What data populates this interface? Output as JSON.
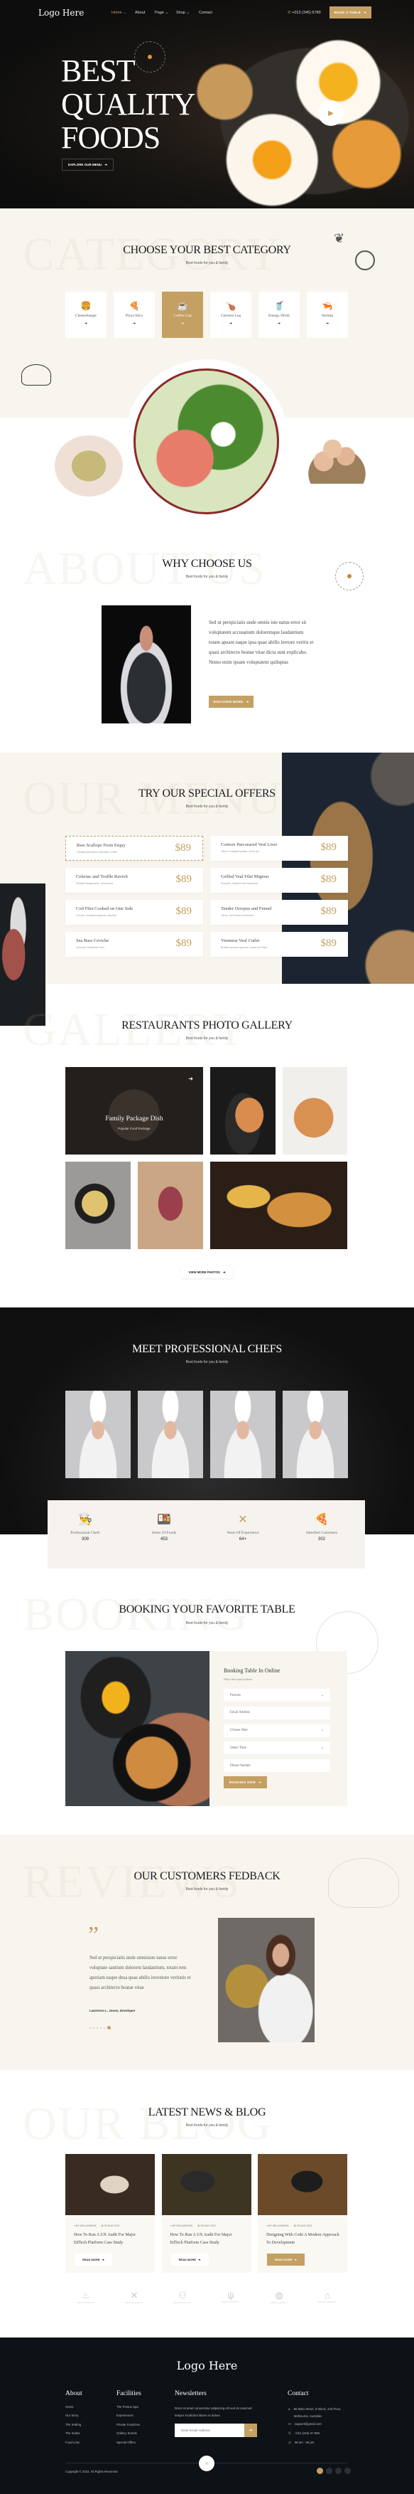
{
  "colors": {
    "accent": "#c4a063",
    "dark": "#0d1114",
    "cream": "#f8f5ef"
  },
  "header": {
    "logo": "Logo Here",
    "nav": [
      {
        "label": "Home",
        "dropdown": true,
        "active": true
      },
      {
        "label": "About",
        "dropdown": false
      },
      {
        "label": "Page",
        "dropdown": true
      },
      {
        "label": "Shop",
        "dropdown": true
      },
      {
        "label": "Contact",
        "dropdown": false
      }
    ],
    "phone": "+012 (345) 6789",
    "book_button": "BOOK A TABLE"
  },
  "hero": {
    "title_lines": [
      "BEST",
      "QUALITY",
      "FOODS"
    ],
    "badge_text": "BEST QUALITY FOODS",
    "explore_button": "EXPLORE OUR MENU",
    "play_icon": "play-icon"
  },
  "category": {
    "watermark": "CATEGORY",
    "title": "CHOOSE YOUR BEST CATEGORY",
    "subtitle": "Best foods for you & family",
    "items": [
      {
        "label": "Cheeseburger",
        "icon": "burger-icon",
        "glyph": "🍔",
        "active": false
      },
      {
        "label": "Pizza Slice",
        "icon": "pizza-icon",
        "glyph": "🍕",
        "active": false
      },
      {
        "label": "Coffee Cup",
        "icon": "coffee-icon",
        "glyph": "☕",
        "active": true
      },
      {
        "label": "Chicken Leg",
        "icon": "chicken-leg-icon",
        "glyph": "🍗",
        "active": false
      },
      {
        "label": "Energy Drink",
        "icon": "drink-icon",
        "glyph": "🥤",
        "active": false
      },
      {
        "label": "Shrimp",
        "icon": "shrimp-icon",
        "glyph": "🦐",
        "active": false
      }
    ]
  },
  "about": {
    "watermark": "ABOUT US",
    "title": "WHY CHOOSE US",
    "subtitle": "Best foods for you & family",
    "text": "Sed ut perspiciatis unde omnis iste natus error sit voluptatem accusatium doloremque laudantium totam apeam eaque ipsa quae abillo invtore veritis et quasi architecto beatae vitae dicta sunt explicabo. Nemo enim ipsam voluptatem quiluptas",
    "button": "DISCOVER MORE"
  },
  "menu": {
    "watermark": "OUR MENU",
    "title": "TRY OUR SPECIAL OFFERS",
    "subtitle": "Best foods for you & family",
    "items": [
      {
        "name": "Raw Scallops From Erquy",
        "desc": "Candied jerusalem artichoke, truffle",
        "price": "$89"
      },
      {
        "name": "Correze Pan-seared Veal Liver",
        "desc": "Olive or mashed potato, onion jus",
        "price": "$89"
      },
      {
        "name": "Celeriac and Truffle Ravioli",
        "desc": "Roasted langoustine, consomme",
        "price": "$89"
      },
      {
        "name": "Grilled Veal Filet Mignon",
        "desc": "Pumpkin, endives with hazelnuts",
        "price": "$89"
      },
      {
        "name": "Cod Filet Cooked on One Side",
        "desc": "Chorizo, chickpea espuma, piquillos",
        "price": "$89"
      },
      {
        "name": "Tender Octopus and Fennel",
        "desc": "Citrus, wild fennel condiment",
        "price": "$89"
      },
      {
        "name": "Sea Bass Ceviche",
        "desc": "Avocado, buttermilk, lime",
        "price": "$89"
      },
      {
        "name": "Viennese Veal Cutlet",
        "desc": "Braised spinach gnocchi, sauce de Pepe",
        "price": "$89"
      }
    ]
  },
  "gallery": {
    "watermark": "GALLERY",
    "title": "RESTAURANTS PHOTO GALLERY",
    "subtitle": "Best foods for you & family",
    "featured_title": "Family Package Dish",
    "featured_sub": "Popular Food Package",
    "button": "VIEW MORE PHOTOS"
  },
  "chefs": {
    "title": "MEET PROFESSIONAL CHEFS",
    "subtitle": "Best foods for you & family",
    "stats": [
      {
        "label": "Professional Chefs",
        "value": "309",
        "icon": "chef-hat-icon",
        "glyph": "👨‍🍳"
      },
      {
        "label": "Items Of Foods",
        "value": "453",
        "icon": "food-items-icon",
        "glyph": "🍱"
      },
      {
        "label": "Years Of Experience",
        "value": "64+",
        "icon": "utensils-icon",
        "glyph": "✕"
      },
      {
        "label": "Satisfied Customers",
        "value": "302",
        "icon": "pizza-slice-icon",
        "glyph": "🍕"
      }
    ]
  },
  "booking": {
    "watermark": "BOOKING",
    "title": "BOOKING YOUR FAVORITE TABLE",
    "subtitle": "Best foods for you & family",
    "form_title": "Booking Table In Online",
    "form_sub": "Fillup the input options",
    "fields": [
      {
        "placeholder": "Persons",
        "select": true
      },
      {
        "placeholder": "Email Address",
        "select": false
      },
      {
        "placeholder": "Choose Date",
        "select": true
      },
      {
        "placeholder": "Select Time",
        "select": true
      },
      {
        "placeholder": "Phone Number",
        "select": false
      }
    ],
    "button": "BOOKING NOW"
  },
  "reviews": {
    "watermark": "REVIEWS",
    "title": "OUR CUSTOMERS FEDBACK",
    "subtitle": "Best foods for you & family",
    "text": "Sed ut perspiciatis unde omnisiste natus error voluptate santium dolorem laudantium, totam rem aperiam eaque desa quae abillo inventore veritatis et quasi architecto beatae vitae",
    "author": "Lawrence L. Jones, Developer",
    "slides": 6,
    "active_slide": 6
  },
  "blog": {
    "watermark": "OUR BLOG",
    "title": "LATEST NEWS & BLOG",
    "subtitle": "Best foods for you & family",
    "posts": [
      {
        "author": "BY WILLIAMSON",
        "date": "25 AUG 2021",
        "title": "How To Run A UX Audit For Major EdTech Platform Case Study",
        "button": "READ MORE",
        "highlight": false
      },
      {
        "author": "BY WILLIAMSON",
        "date": "25 AUG 2021",
        "title": "How To Run A UX Audit For Major EdTech Platform Case Study",
        "button": "READ MORE",
        "highlight": false
      },
      {
        "author": "BY WILLIAMSON",
        "date": "25 AUG 2021",
        "title": "Designing With Code A Modern Approach To Development",
        "button": "READ MORE",
        "highlight": true
      }
    ]
  },
  "partners": [
    "RESTAURANT",
    "RESTAURANT",
    "RESTAURANT",
    "RESTAURANT",
    "RESTAURANT",
    "RESTAURANT"
  ],
  "footer": {
    "logo": "Logo Here",
    "about": {
      "title": "About",
      "links": [
        "Home",
        "Our Story",
        "The Setting",
        "The Suites",
        "Food Lists"
      ]
    },
    "facilities": {
      "title": "Facilities",
      "links": [
        "The Pontus Spa",
        "Experiences",
        "Private Functions",
        "Gallery, Events",
        "Special Offers"
      ]
    },
    "newsletter": {
      "title": "Newsletters",
      "text": "Dolor sit amet consectetur adipiscing elit sed do eiusmod tempor incididunt labore et dolore",
      "placeholder": "Enter Email Address"
    },
    "contact": {
      "title": "Contact",
      "address": "58 Main Street, D Block, 2nd Floor, Melbourne, Australia",
      "email": "support@gmail.com",
      "phone": "+012 (345) 67 899",
      "hours": "08 am - 06 pm"
    },
    "copyright": "Copyright © 2022. All Rights Reserved",
    "social": [
      "facebook-icon",
      "twitter-icon",
      "linkedin-icon",
      "instagram-icon"
    ]
  }
}
